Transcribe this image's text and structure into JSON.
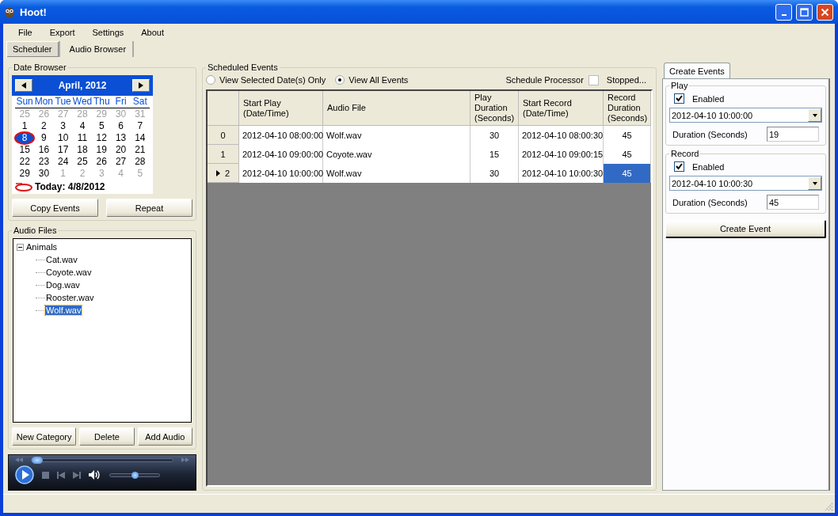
{
  "window": {
    "title": "Hoot!"
  },
  "menu": [
    "File",
    "Export",
    "Settings",
    "About"
  ],
  "tabs": [
    {
      "label": "Scheduler",
      "selected": true
    },
    {
      "label": "Audio Browser",
      "selected": false
    }
  ],
  "date_browser": {
    "title": "Date Browser",
    "month": "April, 2012",
    "day_names": [
      "Sun",
      "Mon",
      "Tue",
      "Wed",
      "Thu",
      "Fri",
      "Sat"
    ],
    "weeks": [
      [
        {
          "d": "25",
          "muted": true,
          "selected": false,
          "today": false
        },
        {
          "d": "26",
          "muted": true,
          "selected": false,
          "today": false
        },
        {
          "d": "27",
          "muted": true,
          "selected": false,
          "today": false
        },
        {
          "d": "28",
          "muted": true,
          "selected": false,
          "today": false
        },
        {
          "d": "29",
          "muted": true,
          "selected": false,
          "today": false
        },
        {
          "d": "30",
          "muted": true,
          "selected": false,
          "today": false
        },
        {
          "d": "31",
          "muted": true,
          "selected": false,
          "today": false
        }
      ],
      [
        {
          "d": "1",
          "muted": false,
          "selected": false,
          "today": false
        },
        {
          "d": "2",
          "muted": false,
          "selected": false,
          "today": false
        },
        {
          "d": "3",
          "muted": false,
          "selected": false,
          "today": false
        },
        {
          "d": "4",
          "muted": false,
          "selected": false,
          "today": false
        },
        {
          "d": "5",
          "muted": false,
          "selected": false,
          "today": false
        },
        {
          "d": "6",
          "muted": false,
          "selected": false,
          "today": false
        },
        {
          "d": "7",
          "muted": false,
          "selected": false,
          "today": false
        }
      ],
      [
        {
          "d": "8",
          "muted": false,
          "selected": true,
          "today": true
        },
        {
          "d": "9",
          "muted": false,
          "selected": false,
          "today": false
        },
        {
          "d": "10",
          "muted": false,
          "selected": false,
          "today": false
        },
        {
          "d": "11",
          "muted": false,
          "selected": false,
          "today": false
        },
        {
          "d": "12",
          "muted": false,
          "selected": false,
          "today": false
        },
        {
          "d": "13",
          "muted": false,
          "selected": false,
          "today": false
        },
        {
          "d": "14",
          "muted": false,
          "selected": false,
          "today": false
        }
      ],
      [
        {
          "d": "15",
          "muted": false,
          "selected": false,
          "today": false
        },
        {
          "d": "16",
          "muted": false,
          "selected": false,
          "today": false
        },
        {
          "d": "17",
          "muted": false,
          "selected": false,
          "today": false
        },
        {
          "d": "18",
          "muted": false,
          "selected": false,
          "today": false
        },
        {
          "d": "19",
          "muted": false,
          "selected": false,
          "today": false
        },
        {
          "d": "20",
          "muted": false,
          "selected": false,
          "today": false
        },
        {
          "d": "21",
          "muted": false,
          "selected": false,
          "today": false
        }
      ],
      [
        {
          "d": "22",
          "muted": false,
          "selected": false,
          "today": false
        },
        {
          "d": "23",
          "muted": false,
          "selected": false,
          "today": false
        },
        {
          "d": "24",
          "muted": false,
          "selected": false,
          "today": false
        },
        {
          "d": "25",
          "muted": false,
          "selected": false,
          "today": false
        },
        {
          "d": "26",
          "muted": false,
          "selected": false,
          "today": false
        },
        {
          "d": "27",
          "muted": false,
          "selected": false,
          "today": false
        },
        {
          "d": "28",
          "muted": false,
          "selected": false,
          "today": false
        }
      ],
      [
        {
          "d": "29",
          "muted": false,
          "selected": false,
          "today": false
        },
        {
          "d": "30",
          "muted": false,
          "selected": false,
          "today": false
        },
        {
          "d": "1",
          "muted": true,
          "selected": false,
          "today": false
        },
        {
          "d": "2",
          "muted": true,
          "selected": false,
          "today": false
        },
        {
          "d": "3",
          "muted": true,
          "selected": false,
          "today": false
        },
        {
          "d": "4",
          "muted": true,
          "selected": false,
          "today": false
        },
        {
          "d": "5",
          "muted": true,
          "selected": false,
          "today": false
        }
      ]
    ],
    "today": "Today: 4/8/2012",
    "buttons": [
      "Copy Events",
      "Repeat"
    ]
  },
  "audio_files": {
    "title": "Audio Files",
    "tree": [
      {
        "label": "Animals",
        "expanded": true,
        "selected": false,
        "children": [
          {
            "label": "Cat.wav",
            "selected": false
          },
          {
            "label": "Coyote.wav",
            "selected": false
          },
          {
            "label": "Dog.wav",
            "selected": false
          },
          {
            "label": "Rooster.wav",
            "selected": false
          },
          {
            "label": "Wolf.wav",
            "selected": true
          }
        ]
      }
    ],
    "buttons": [
      "New Category",
      "Delete",
      "Add Audio"
    ]
  },
  "player": {
    "seek": {
      "level": 0.04
    },
    "volume": {
      "level": 0.5
    }
  },
  "scheduled_events": {
    "title": "Scheduled Events",
    "view_options": [
      {
        "label": "View Selected Date(s) Only",
        "selected": false
      },
      {
        "label": "View All Events",
        "selected": true
      }
    ],
    "processor_label": "Schedule Processor",
    "processor": {
      "label": "Stopped...",
      "checked": false
    },
    "columns": [
      "Start Play (Date/Time)",
      "Audio File",
      "Play Duration (Seconds)",
      "Start Record (Date/Time)",
      "Record Duration (Seconds)"
    ],
    "rows": [
      {
        "index": "0",
        "current": false,
        "cells": [
          {
            "text": "2012-04-10 08:00:00",
            "selected": false
          },
          {
            "text": "Wolf.wav",
            "selected": false
          },
          {
            "text": "30",
            "selected": false
          },
          {
            "text": "2012-04-10 08:00:30",
            "selected": false
          },
          {
            "text": "45",
            "selected": false
          }
        ]
      },
      {
        "index": "1",
        "current": false,
        "cells": [
          {
            "text": "2012-04-10 09:00:00",
            "selected": false
          },
          {
            "text": "Coyote.wav",
            "selected": false
          },
          {
            "text": "15",
            "selected": false
          },
          {
            "text": "2012-04-10 09:00:15",
            "selected": false
          },
          {
            "text": "45",
            "selected": false
          }
        ]
      },
      {
        "index": "2",
        "current": true,
        "cells": [
          {
            "text": "2012-04-10 10:00:00",
            "selected": false
          },
          {
            "text": "Wolf.wav",
            "selected": false
          },
          {
            "text": "30",
            "selected": false
          },
          {
            "text": "2012-04-10 10:00:30",
            "selected": false
          },
          {
            "text": "45",
            "selected": true
          }
        ]
      }
    ]
  },
  "create_events": {
    "tab": "Create Events",
    "groups": [
      {
        "title": "Play",
        "enabled": {
          "label": "Enabled",
          "checked": true
        },
        "datetime": "2012-04-10 10:00:00",
        "duration_label": "Duration (Seconds)",
        "duration": "19"
      },
      {
        "title": "Record",
        "enabled": {
          "label": "Enabled",
          "checked": true
        },
        "datetime": "2012-04-10 10:00:30",
        "duration_label": "Duration (Seconds)",
        "duration": "45"
      }
    ],
    "button": "Create Event"
  }
}
